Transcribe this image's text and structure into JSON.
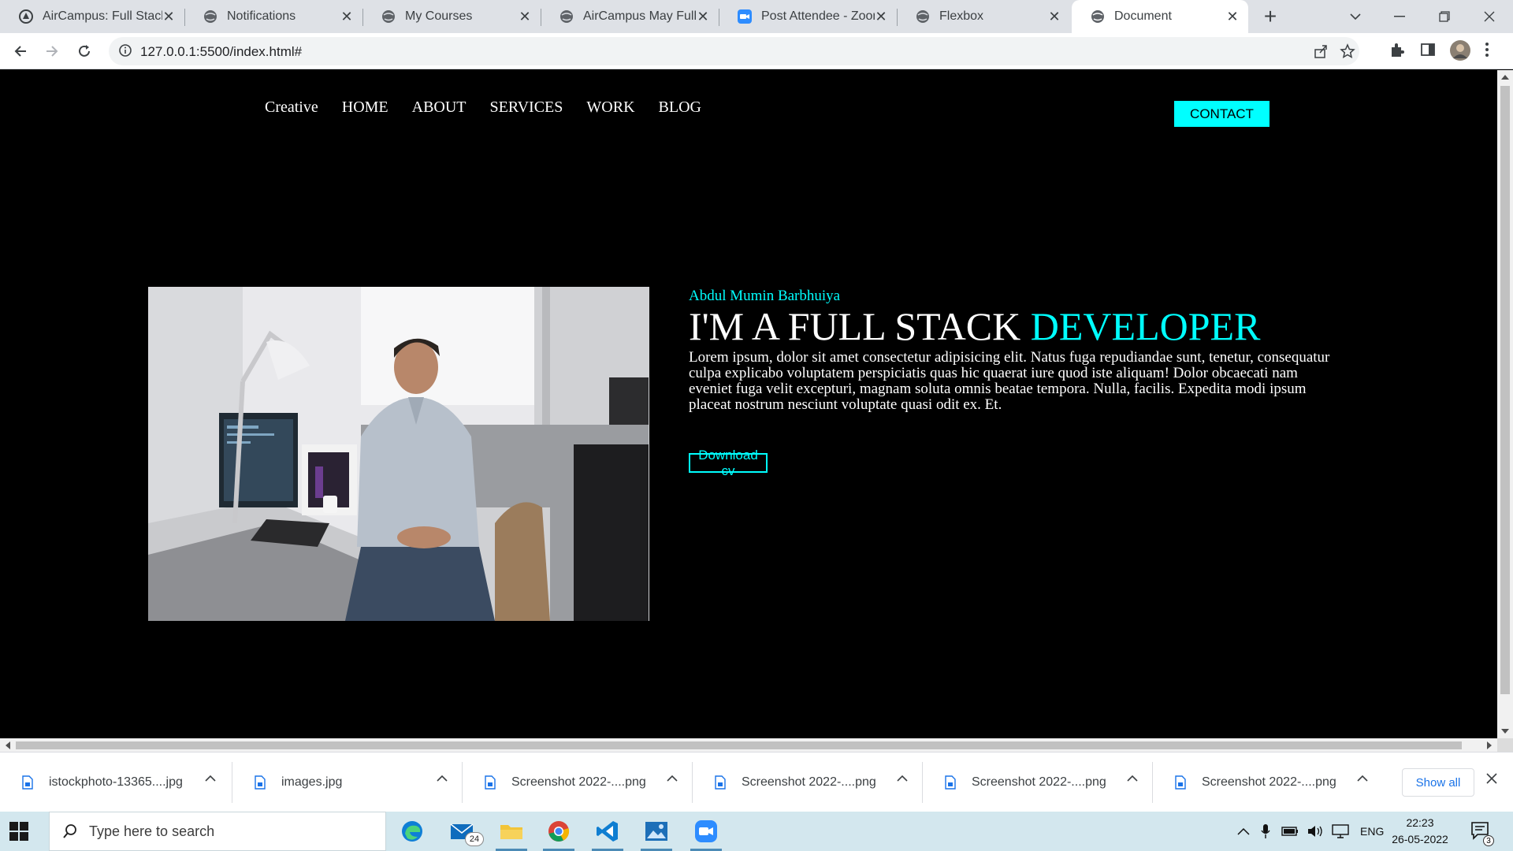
{
  "browser": {
    "tabs": [
      {
        "title": "AirCampus: Full Stack",
        "icon": "aircampus-icon"
      },
      {
        "title": "Notifications",
        "icon": "globe-icon"
      },
      {
        "title": "My Courses",
        "icon": "globe-icon"
      },
      {
        "title": "AirCampus May Full S",
        "icon": "globe-icon"
      },
      {
        "title": "Post Attendee - Zoom",
        "icon": "zoom-icon"
      },
      {
        "title": "Flexbox",
        "icon": "globe-icon"
      },
      {
        "title": "Document",
        "icon": "globe-icon",
        "active": true
      }
    ],
    "url": "127.0.0.1:5500/index.html#"
  },
  "page": {
    "nav": {
      "brand": "Creative",
      "items": [
        "HOME",
        "ABOUT",
        "SERVICES",
        "WORK",
        "BLOG"
      ],
      "contact_label": "CONTACT"
    },
    "hero": {
      "name": "Abdul Mumin Barbhuiya",
      "title_prefix": "I'M A FULL STACK",
      "title_accent": "DEVELOPER",
      "description": "Lorem ipsum, dolor sit amet consectetur adipisicing elit. Natus fuga repudiandae sunt, tenetur, consequatur culpa explicabo voluptatem perspiciatis quas hic quaerat iure quod iste aliquam! Dolor obcaecati nam eveniet fuga velit excepturi, magnam soluta omnis beatae tempora. Nulla, facilis. Expedita modi ipsum placeat nostrum nesciunt voluptate quasi odit ex. Et.",
      "cv_label": "Download cv"
    },
    "accent_color": "#00ffff"
  },
  "downloads": {
    "items": [
      "istockphoto-13365....jpg",
      "images.jpg",
      "Screenshot 2022-....png",
      "Screenshot 2022-....png",
      "Screenshot 2022-....png",
      "Screenshot 2022-....png"
    ],
    "show_all": "Show all"
  },
  "taskbar": {
    "search_placeholder": "Type here to search",
    "mail_badge": "24",
    "language": "ENG",
    "time": "22:23",
    "date": "26-05-2022",
    "notification_count": "3"
  }
}
